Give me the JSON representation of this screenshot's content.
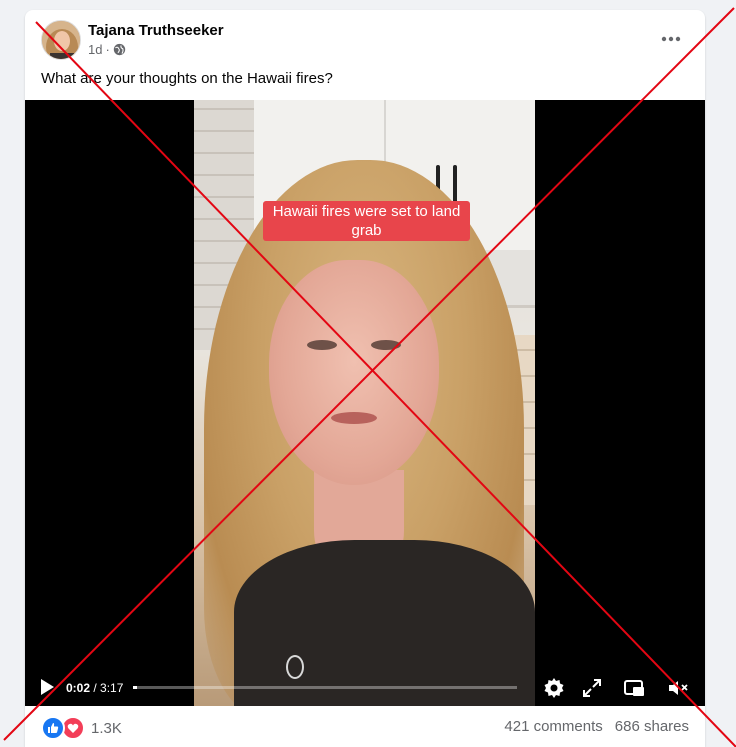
{
  "post": {
    "author": "Tajana Truthseeker",
    "time": "1d",
    "audience_icon": "globe-icon",
    "more_icon": "more-options-icon",
    "caption": "What are your thoughts on the Hawaii fires?"
  },
  "video": {
    "overlay_text": "Hawaii fires were set to land grab",
    "current_time": "0:02",
    "duration": "3:17",
    "progress_fraction": 0.01,
    "controls": [
      "play-icon",
      "settings-icon",
      "fullscreen-icon",
      "miniplayer-icon",
      "muted-icon"
    ]
  },
  "engagement": {
    "reactions": [
      "like-icon",
      "love-icon"
    ],
    "reaction_count": "1.3K",
    "comments": "421 comments",
    "shares": "686 shares"
  },
  "colors": {
    "x_mark": "#e30613",
    "like": "#1877f2",
    "love": "#f33e58",
    "overlay_label": "#e8454b"
  }
}
